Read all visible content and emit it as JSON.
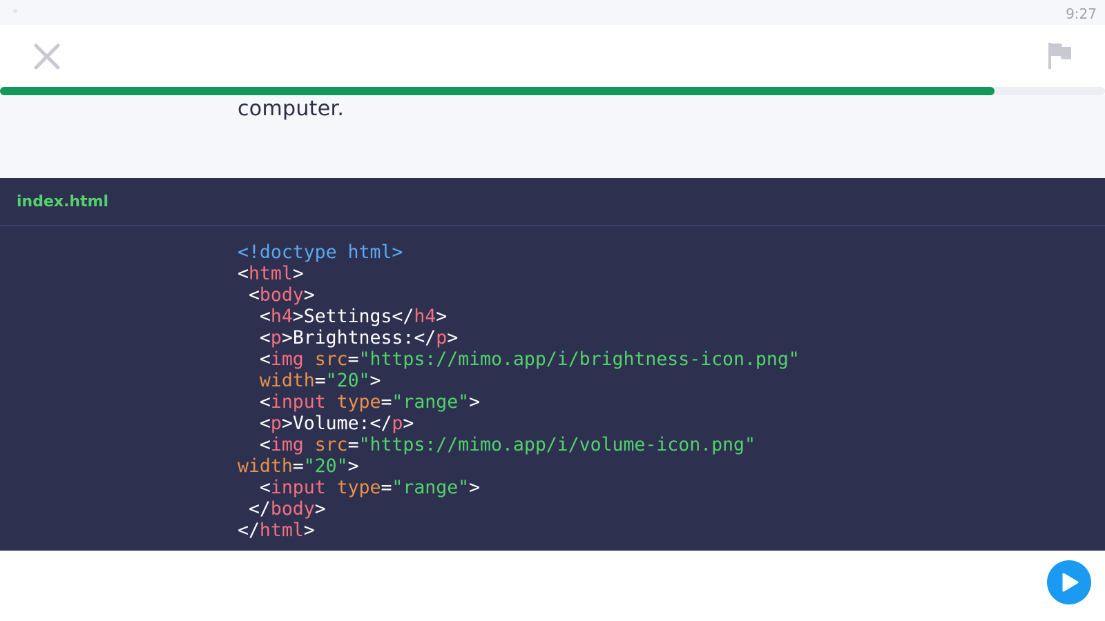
{
  "status_bar": {
    "time": "9:27"
  },
  "top_bar": {
    "close_icon": "close-icon",
    "flag_icon": "flag-icon",
    "progress_percent": 90
  },
  "instruction": {
    "text": "computer."
  },
  "editor": {
    "file_tab": "index.html",
    "code_lines": [
      [
        [
          "doctype",
          "<!doctype html>"
        ]
      ],
      [
        [
          "punc",
          "<"
        ],
        [
          "tag",
          "html"
        ],
        [
          "punc",
          ">"
        ]
      ],
      [
        [
          "punc",
          " <"
        ],
        [
          "tag",
          "body"
        ],
        [
          "punc",
          ">"
        ]
      ],
      [
        [
          "punc",
          "  <"
        ],
        [
          "tag",
          "h4"
        ],
        [
          "punc",
          ">"
        ],
        [
          "text",
          "Settings"
        ],
        [
          "punc",
          "</"
        ],
        [
          "tag",
          "h4"
        ],
        [
          "punc",
          ">"
        ]
      ],
      [
        [
          "punc",
          "  <"
        ],
        [
          "tag",
          "p"
        ],
        [
          "punc",
          ">"
        ],
        [
          "text",
          "Brightness:"
        ],
        [
          "punc",
          "</"
        ],
        [
          "tag",
          "p"
        ],
        [
          "punc",
          ">"
        ]
      ],
      [
        [
          "punc",
          "  <"
        ],
        [
          "tag",
          "img"
        ],
        [
          "punc",
          " "
        ],
        [
          "attr",
          "src"
        ],
        [
          "punc",
          "="
        ],
        [
          "str",
          "\"https://mimo.app/i/brightness-icon.png\""
        ]
      ],
      [
        [
          "punc",
          "  "
        ],
        [
          "attr",
          "width"
        ],
        [
          "punc",
          "="
        ],
        [
          "str",
          "\"20\""
        ],
        [
          "punc",
          ">"
        ]
      ],
      [
        [
          "punc",
          "  <"
        ],
        [
          "tag",
          "input"
        ],
        [
          "punc",
          " "
        ],
        [
          "attr",
          "type"
        ],
        [
          "punc",
          "="
        ],
        [
          "str",
          "\"range\""
        ],
        [
          "punc",
          ">"
        ]
      ],
      [
        [
          "punc",
          "  <"
        ],
        [
          "tag",
          "p"
        ],
        [
          "punc",
          ">"
        ],
        [
          "text",
          "Volume:"
        ],
        [
          "punc",
          "</"
        ],
        [
          "tag",
          "p"
        ],
        [
          "punc",
          ">"
        ]
      ],
      [
        [
          "punc",
          "  <"
        ],
        [
          "tag",
          "img"
        ],
        [
          "punc",
          " "
        ],
        [
          "attr",
          "src"
        ],
        [
          "punc",
          "="
        ],
        [
          "str",
          "\"https://mimo.app/i/volume-icon.png\""
        ]
      ],
      [
        [
          "attr",
          "width"
        ],
        [
          "punc",
          "="
        ],
        [
          "str",
          "\"20\""
        ],
        [
          "punc",
          ">"
        ]
      ],
      [
        [
          "punc",
          "  <"
        ],
        [
          "tag",
          "input"
        ],
        [
          "punc",
          " "
        ],
        [
          "attr",
          "type"
        ],
        [
          "punc",
          "="
        ],
        [
          "str",
          "\"range\""
        ],
        [
          "punc",
          ">"
        ]
      ],
      [
        [
          "punc",
          " </"
        ],
        [
          "tag",
          "body"
        ],
        [
          "punc",
          ">"
        ]
      ],
      [
        [
          "punc",
          "</"
        ],
        [
          "tag",
          "html"
        ],
        [
          "punc",
          ">"
        ]
      ]
    ]
  },
  "bottom_bar": {
    "run_icon": "play-icon"
  },
  "colors": {
    "accent_green": "#12985a",
    "run_button": "#1a9af0",
    "editor_bg": "#2e3050",
    "file_tab": "#52d26b"
  }
}
